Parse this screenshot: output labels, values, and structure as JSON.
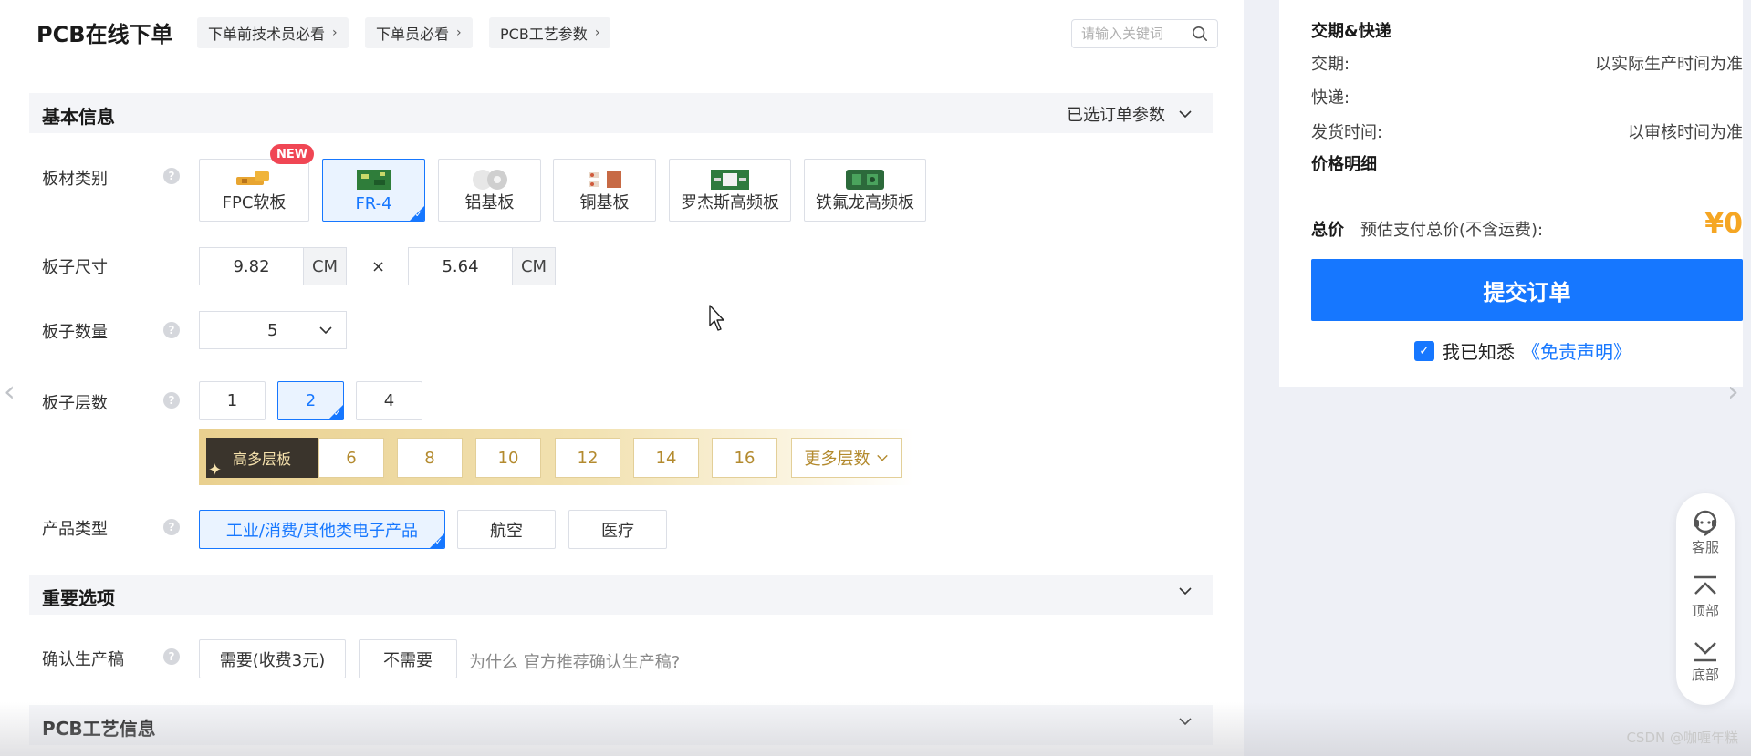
{
  "header": {
    "title": "PCB在线下单",
    "breadcrumbs": [
      {
        "label": "下单前技术员必看"
      },
      {
        "label": "下单员必看"
      },
      {
        "label": "PCB工艺参数"
      }
    ],
    "search": {
      "placeholder": "请输入关键词"
    }
  },
  "sections": {
    "basic": {
      "title": "基本信息",
      "right_label": "已选订单参数"
    },
    "important": {
      "title": "重要选项"
    },
    "craft": {
      "title": "PCB工艺信息"
    }
  },
  "fields": {
    "material": {
      "label": "板材类别",
      "options": [
        "FPC软板",
        "FR-4",
        "铝基板",
        "铜基板",
        "罗杰斯高频板",
        "铁氟龙高频板"
      ],
      "selected": "FR-4",
      "badge": "NEW"
    },
    "size": {
      "label": "板子尺寸",
      "width": "9.82",
      "height": "5.64",
      "unit": "CM",
      "times": "×"
    },
    "quantity": {
      "label": "板子数量",
      "value": "5"
    },
    "layers": {
      "label": "板子层数",
      "options": [
        "1",
        "2",
        "4"
      ],
      "selected": "2",
      "high_label": "高多层板",
      "high_options": [
        "6",
        "8",
        "10",
        "12",
        "14",
        "16"
      ],
      "more_label": "更多层数"
    },
    "product": {
      "label": "产品类型",
      "options": [
        "工业/消费/其他类电子产品",
        "航空",
        "医疗"
      ],
      "selected": "工业/消费/其他类电子产品"
    },
    "confirm": {
      "label": "确认生产稿",
      "options": [
        "需要(收费3元)",
        "不需要"
      ],
      "note": "为什么 官方推荐确认生产稿?"
    }
  },
  "summary": {
    "delivery_title": "交期&快递",
    "rows": [
      {
        "label": "交期:",
        "value": "以实际生产时间为准"
      },
      {
        "label": "快递:",
        "value": ""
      },
      {
        "label": "发货时间:",
        "value": "以审核时间为准"
      }
    ],
    "price_title": "价格明细",
    "total_label": "总价",
    "total_desc": "预估支付总价(不含运费):",
    "total_value": "¥0",
    "submit_label": "提交订单",
    "agree_text": "我已知悉",
    "agree_link": "《免责声明》"
  },
  "float_bar": [
    {
      "label": "客服",
      "icon": "headset-icon"
    },
    {
      "label": "顶部",
      "icon": "to-top-icon"
    },
    {
      "label": "底部",
      "icon": "to-bottom-icon"
    }
  ],
  "watermark": "CSDN @咖喱年糕",
  "colors": {
    "accent": "#1677ff",
    "price": "#f5a623",
    "badge": "#f04654",
    "gold": "#b38a2e"
  }
}
